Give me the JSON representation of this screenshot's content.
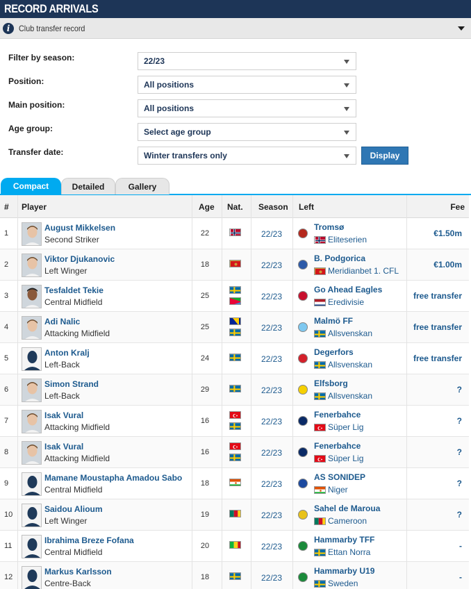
{
  "header": {
    "title": "RECORD ARRIVALS"
  },
  "subheader": {
    "title": "Club transfer record",
    "info_icon": "info-icon",
    "collapse_icon": "chevron-down-icon"
  },
  "filters": {
    "season": {
      "label": "Filter by season:",
      "value": "22/23"
    },
    "position": {
      "label": "Position:",
      "value": "All positions"
    },
    "main_position": {
      "label": "Main position:",
      "value": "All positions"
    },
    "age_group": {
      "label": "Age group:",
      "value": "Select age group"
    },
    "transfer_date": {
      "label": "Transfer date:",
      "value": "Winter transfers only"
    },
    "display_label": "Display"
  },
  "tabs": [
    "Compact",
    "Detailed",
    "Gallery"
  ],
  "columns": {
    "num": "#",
    "player": "Player",
    "age": "Age",
    "nat": "Nat.",
    "season": "Season",
    "left": "Left",
    "fee": "Fee"
  },
  "rows": [
    {
      "num": "1",
      "name": "August Mikkelsen",
      "position": "Second Striker",
      "age": "22",
      "nat": [
        "norway"
      ],
      "season": "22/23",
      "club": "Tromsø",
      "club_color": "#b5281d",
      "league_flag": "norway",
      "league": "Eliteserien",
      "fee": "€1.50m",
      "photo": "face-light"
    },
    {
      "num": "2",
      "name": "Viktor Djukanovic",
      "position": "Left Winger",
      "age": "18",
      "nat": [
        "montenegro"
      ],
      "season": "22/23",
      "club": "B. Podgorica",
      "club_color": "#2d5aa8",
      "league_flag": "montenegro",
      "league": "Meridianbet 1. CFL",
      "fee": "€1.00m",
      "photo": "face-light"
    },
    {
      "num": "3",
      "name": "Tesfaldet Tekie",
      "position": "Central Midfield",
      "age": "25",
      "nat": [
        "sweden",
        "eritrea"
      ],
      "season": "22/23",
      "club": "Go Ahead Eagles",
      "club_color": "#c8102e",
      "league_flag": "netherlands",
      "league": "Eredivisie",
      "fee": "free transfer",
      "photo": "face-dark"
    },
    {
      "num": "4",
      "name": "Adi Nalic",
      "position": "Attacking Midfield",
      "age": "25",
      "nat": [
        "bosnia",
        "sweden"
      ],
      "season": "22/23",
      "club": "Malmö FF",
      "club_color": "#7ec8f0",
      "league_flag": "sweden",
      "league": "Allsvenskan",
      "fee": "free transfer",
      "photo": "face-light"
    },
    {
      "num": "5",
      "name": "Anton Kralj",
      "position": "Left-Back",
      "age": "24",
      "nat": [
        "sweden"
      ],
      "season": "22/23",
      "club": "Degerfors",
      "club_color": "#d4202a",
      "league_flag": "sweden",
      "league": "Allsvenskan",
      "fee": "free transfer",
      "photo": "silhouette"
    },
    {
      "num": "6",
      "name": "Simon Strand",
      "position": "Left-Back",
      "age": "29",
      "nat": [
        "sweden"
      ],
      "season": "22/23",
      "club": "Elfsborg",
      "club_color": "#f6d000",
      "league_flag": "sweden",
      "league": "Allsvenskan",
      "fee": "?",
      "photo": "face-light"
    },
    {
      "num": "7",
      "name": "Isak Vural",
      "position": "Attacking Midfield",
      "age": "16",
      "nat": [
        "turkey",
        "sweden"
      ],
      "season": "22/23",
      "club": "Fenerbahce",
      "club_color": "#0a2a66",
      "league_flag": "turkey",
      "league": "Süper Lig",
      "fee": "?",
      "photo": "face-light"
    },
    {
      "num": "8",
      "name": "Isak Vural",
      "position": "Attacking Midfield",
      "age": "16",
      "nat": [
        "turkey",
        "sweden"
      ],
      "season": "22/23",
      "club": "Fenerbahce",
      "club_color": "#0a2a66",
      "league_flag": "turkey",
      "league": "Süper Lig",
      "fee": "?",
      "photo": "face-light"
    },
    {
      "num": "9",
      "name": "Mamane Moustapha Amadou Sabo",
      "position": "Central Midfield",
      "age": "18",
      "nat": [
        "niger"
      ],
      "season": "22/23",
      "club": "AS SONIDEP",
      "club_color": "#1c4aa0",
      "league_flag": "niger",
      "league": "Niger",
      "fee": "?",
      "photo": "silhouette"
    },
    {
      "num": "10",
      "name": "Saidou Alioum",
      "position": "Left Winger",
      "age": "19",
      "nat": [
        "cameroon"
      ],
      "season": "22/23",
      "club": "Sahel de Maroua",
      "club_color": "#e8c21a",
      "league_flag": "cameroon",
      "league": "Cameroon",
      "fee": "?",
      "photo": "silhouette"
    },
    {
      "num": "11",
      "name": "Ibrahima Breze Fofana",
      "position": "Central Midfield",
      "age": "20",
      "nat": [
        "mali"
      ],
      "season": "22/23",
      "club": "Hammarby TFF",
      "club_color": "#1a8a3a",
      "league_flag": "sweden",
      "league": "Ettan Norra",
      "fee": "-",
      "photo": "silhouette"
    },
    {
      "num": "12",
      "name": "Markus Karlsson",
      "position": "Centre-Back",
      "age": "18",
      "nat": [
        "sweden"
      ],
      "season": "22/23",
      "club": "Hammarby U19",
      "club_color": "#1a8a3a",
      "league_flag": "sweden",
      "league": "Sweden",
      "fee": "-",
      "photo": "silhouette"
    }
  ]
}
